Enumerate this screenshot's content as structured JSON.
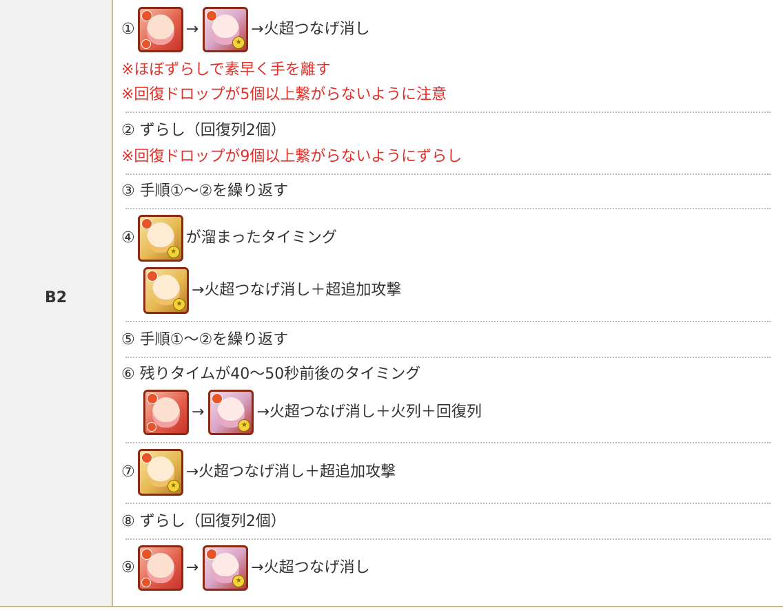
{
  "row_label": "B2",
  "icons": {
    "pink": "pink-hair-fire-card-icon",
    "lilac": "lilac-hair-fire-card-icon",
    "gold": "blonde-fire-card-icon"
  },
  "steps": {
    "s1_num": "①",
    "s1_arrow": "→",
    "s1_text": "→火超つなげ消し",
    "s1_note1": "※ほぼずらしで素早く手を離す",
    "s1_note2": "※回復ドロップが5個以上繋がらないように注意",
    "s2_text": "② ずらし（回復列2個）",
    "s2_note": "※回復ドロップが9個以上繋がらないようにずらし",
    "s3_text": "③ 手順①〜②を繰り返す",
    "s4_num": "④",
    "s4_text1": "が溜まったタイミング",
    "s4_text2": "→火超つなげ消し＋超追加攻撃",
    "s5_text": "⑤ 手順①〜②を繰り返す",
    "s6_text": "⑥ 残りタイムが40〜50秒前後のタイミング",
    "s6_arrow": "→",
    "s6_text2": "→火超つなげ消し＋火列＋回復列",
    "s7_num": "⑦",
    "s7_text": "→火超つなげ消し＋超追加攻撃",
    "s8_text": "⑧ ずらし（回復列2個）",
    "s9_num": "⑨",
    "s9_arrow": "→",
    "s9_text": "→火超つなげ消し"
  }
}
